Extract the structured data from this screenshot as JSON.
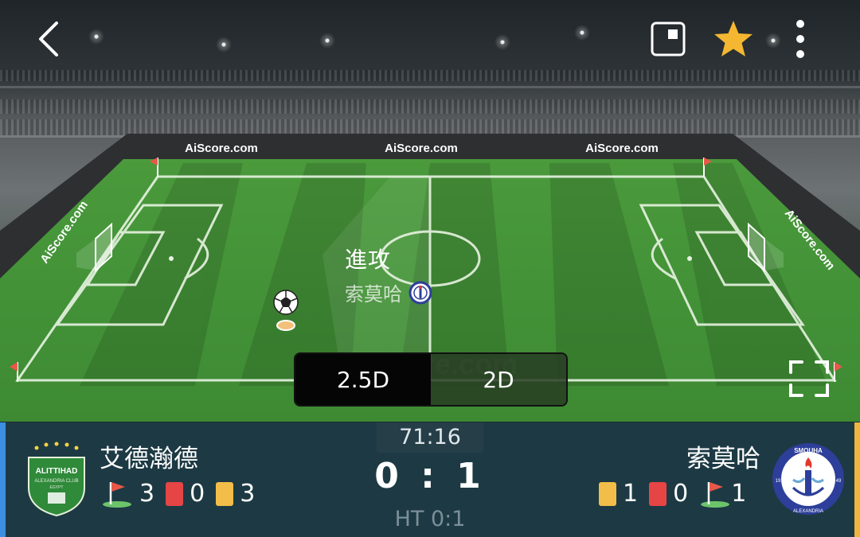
{
  "header": {
    "back_icon": "chevron-left-icon",
    "pip_icon": "picture-in-picture-icon",
    "favorite_icon": "star-icon",
    "favorite_color": "#f5b731",
    "more_icon": "more-vertical-icon"
  },
  "pitch": {
    "board_text": "AiScore.com",
    "event_label": "進攻",
    "event_team": "索莫哈",
    "watermark": "AiScore.com"
  },
  "view_toggle": {
    "options": [
      "2.5D",
      "2D"
    ],
    "selected": "2.5D"
  },
  "fullscreen_icon": "fullscreen-icon",
  "match": {
    "clock": "71:16",
    "score": "0 : 1",
    "half_time": "HT 0:1",
    "home": {
      "name": "艾德瀚德",
      "logo_text": "ALITTIHAD",
      "logo_sub": "ALEXANDRIA CLUB",
      "logo_country": "EGYPT",
      "corners": "3",
      "red_cards": "0",
      "yellow_cards": "3",
      "color": "#3c8ee0"
    },
    "away": {
      "name": "索莫哈",
      "logo_text": "SMOUHA",
      "logo_sub": "ALEXANDRIA",
      "logo_year_left": "19",
      "logo_year_right": "49",
      "yellow_cards": "1",
      "red_cards": "0",
      "corners": "1",
      "color": "#f0b63c"
    }
  }
}
